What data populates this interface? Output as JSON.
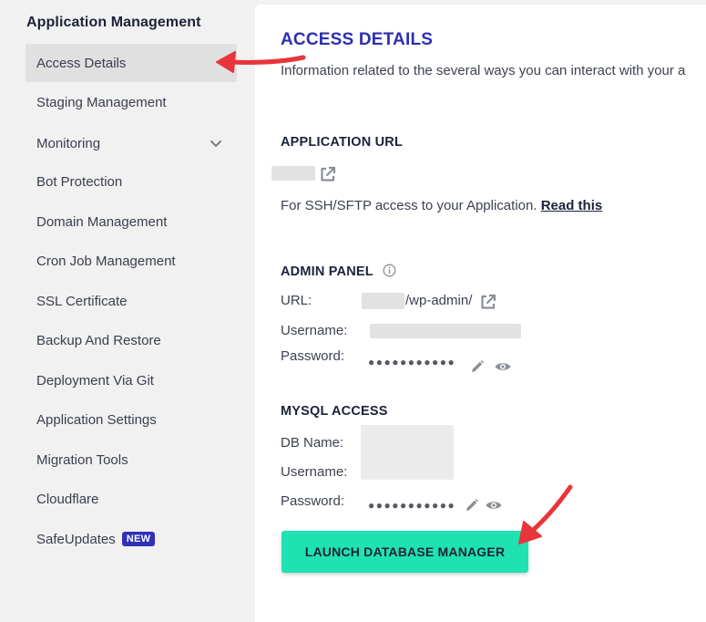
{
  "sidebar": {
    "heading": "Application Management",
    "items": [
      {
        "label": "Access Details"
      },
      {
        "label": "Staging Management"
      },
      {
        "label": "Monitoring"
      },
      {
        "label": "Bot Protection"
      },
      {
        "label": "Domain Management"
      },
      {
        "label": "Cron Job Management"
      },
      {
        "label": "SSL Certificate"
      },
      {
        "label": "Backup And Restore"
      },
      {
        "label": "Deployment Via Git"
      },
      {
        "label": "Application Settings"
      },
      {
        "label": "Migration Tools"
      },
      {
        "label": "Cloudflare"
      },
      {
        "label": "SafeUpdates",
        "badge": "NEW"
      }
    ]
  },
  "main": {
    "title": "ACCESS DETAILS",
    "description": "Information related to the several ways you can interact with your a",
    "application_url": {
      "heading": "APPLICATION URL",
      "help_text": "For SSH/SFTP access to your Application.",
      "help_link": "Read this"
    },
    "admin_panel": {
      "heading": "ADMIN PANEL",
      "url_label": "URL:",
      "url_suffix": "/wp-admin/",
      "username_label": "Username:",
      "password_label": "Password:",
      "password_mask": "●●●●●●●●●●●"
    },
    "mysql": {
      "heading": "MYSQL ACCESS",
      "db_name_label": "DB Name:",
      "username_label": "Username:",
      "password_label": "Password:",
      "password_mask": "●●●●●●●●●●●",
      "launch_button": "LAUNCH DATABASE MANAGER"
    }
  },
  "colors": {
    "accent": "#2c2fb0",
    "launch_button": "#1fe2b1",
    "annotation_arrow": "#e8353b",
    "badge": "#3130b9"
  }
}
